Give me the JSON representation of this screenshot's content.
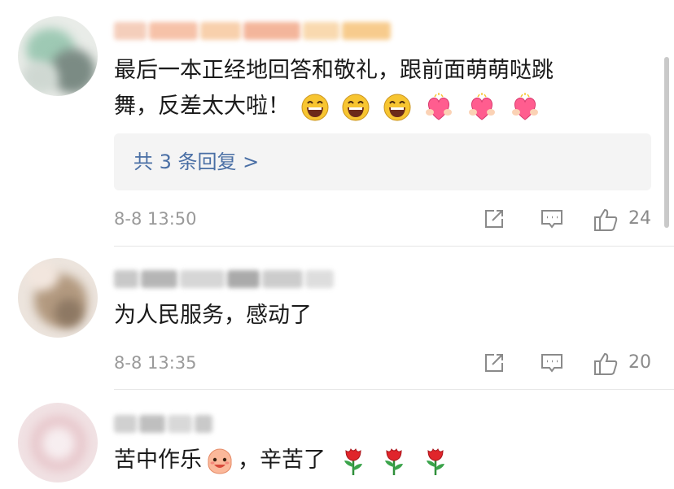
{
  "comments": [
    {
      "text_line1": "最后一本正经地回答和敬礼，跟前面萌萌哒跳",
      "text_line2": "舞，反差太大啦！",
      "reply_summary": "共 3 条回复 >",
      "time": "8-8 13:50",
      "likes": "24",
      "emojis": [
        "laugh-emoji",
        "laugh-emoji",
        "laugh-emoji",
        "heart-hands-emoji",
        "heart-hands-emoji",
        "heart-hands-emoji"
      ]
    },
    {
      "text_line1": "为人民服务，感动了",
      "time": "8-8 13:35",
      "likes": "20"
    },
    {
      "text_line1_a": "苦中作乐",
      "text_line1_b": "，辛苦了",
      "emojis": [
        "cute-monster-emoji",
        "rose-emoji",
        "rose-emoji",
        "rose-emoji"
      ]
    }
  ],
  "icons": {
    "share": "share-icon",
    "comment": "comment-icon",
    "like": "thumbs-up-icon"
  },
  "colors": {
    "link": "#4a6fa5",
    "meta": "#9a9a9a",
    "reply_bg": "#f4f4f4"
  }
}
